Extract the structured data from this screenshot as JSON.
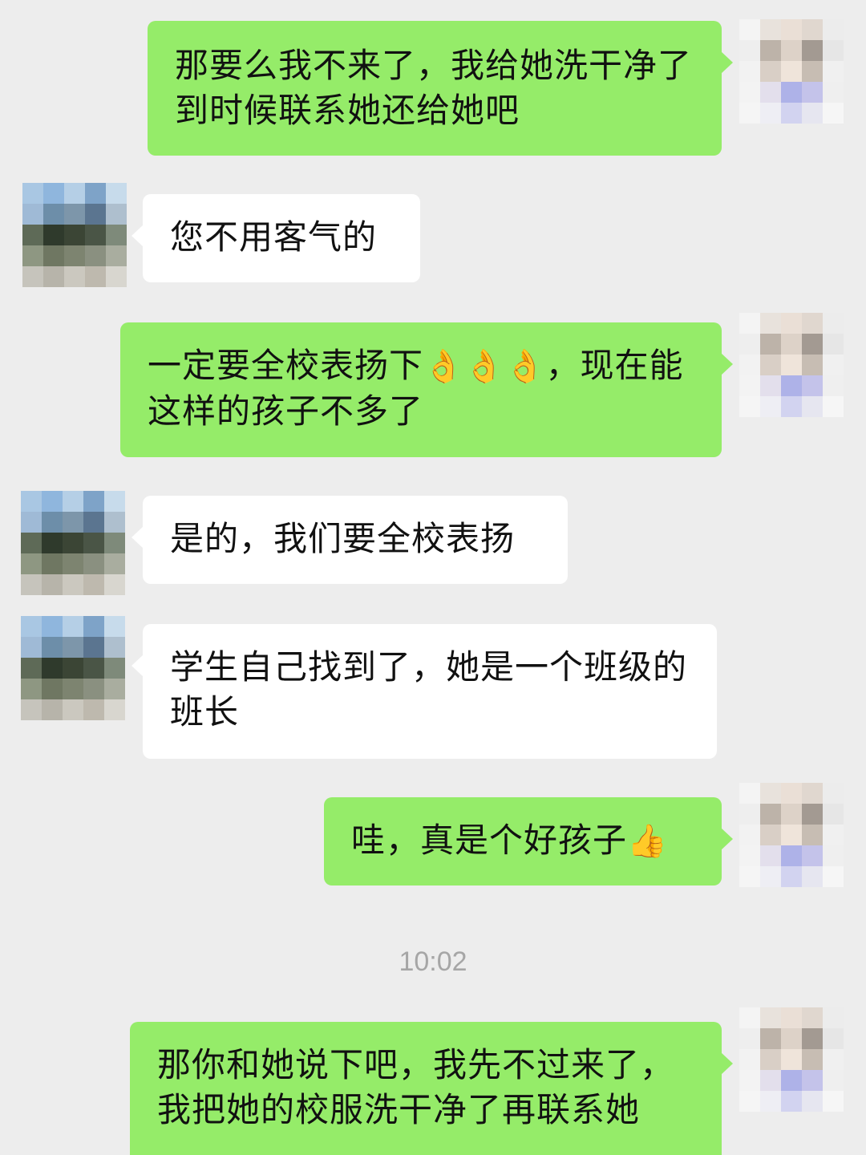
{
  "messages": [
    {
      "side": "out",
      "text": "那要么我不来了，我给她洗干净了到时候联系她还给她吧"
    },
    {
      "side": "in",
      "text": "您不用客气的"
    },
    {
      "side": "out",
      "text_before": "一定要全校表扬下",
      "emoji": "👌👌👌",
      "text_after": "，现在能这样的孩子不多了"
    },
    {
      "side": "in",
      "text": "是的，我们要全校表扬"
    },
    {
      "side": "in",
      "text": "学生自己找到了，她是一个班级的班长"
    },
    {
      "side": "out",
      "text": "哇，真是个好孩子",
      "emoji": "👍"
    },
    {
      "side": "out",
      "text": "那你和她说下吧，我先不过来了，我把她的校服洗干净了再联系她"
    }
  ],
  "timestamp": "10:02",
  "icons": {
    "avatar_self": "avatar-self-pixelated",
    "avatar_other": "avatar-other-pixelated"
  },
  "colors": {
    "background": "#ededed",
    "outgoing_bubble": "#95ec69",
    "incoming_bubble": "#ffffff",
    "timestamp_text": "#a6a6a6"
  }
}
